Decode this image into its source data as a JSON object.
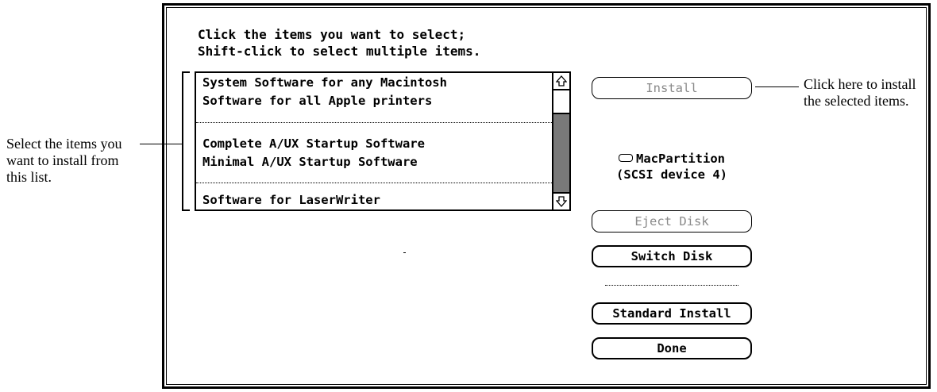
{
  "instructions": {
    "line1": "Click the items you want to select;",
    "line2": "Shift-click to select multiple items."
  },
  "list": {
    "items": [
      "System Software for any Macintosh",
      "Software for all Apple printers",
      "Complete A/UX Startup Software",
      "Minimal A/UX Startup Software",
      "Software for LaserWriter"
    ],
    "scroll_up_icon": "up-arrow-icon",
    "scroll_down_icon": "down-arrow-icon"
  },
  "buttons": {
    "install": "Install",
    "eject": "Eject Disk",
    "switch": "Switch Disk",
    "standard_install": "Standard Install",
    "done": "Done"
  },
  "disk": {
    "name": "MacPartition",
    "device": "(SCSI device 4)",
    "icon": "disk-icon"
  },
  "callouts": {
    "left": [
      "Select the items you",
      "want to install from",
      "this list."
    ],
    "right": [
      "Click here to install",
      "the selected items."
    ]
  }
}
